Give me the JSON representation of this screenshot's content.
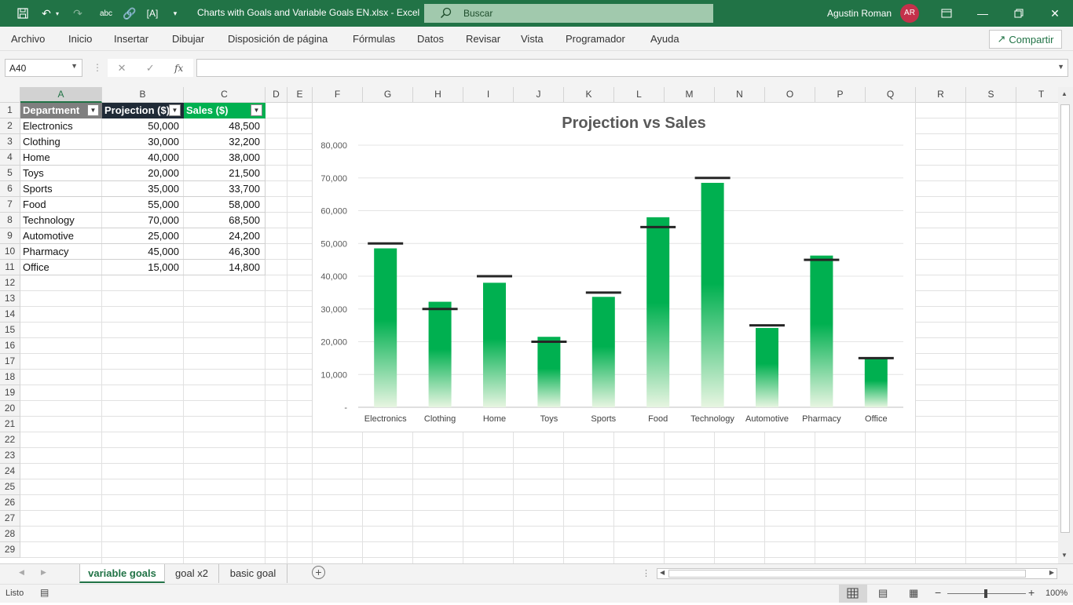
{
  "titlebar": {
    "title": "Charts with Goals and Variable Goals EN.xlsx  -  Excel",
    "search_placeholder": "Buscar",
    "user_name": "Agustin Roman",
    "user_initials": "AR"
  },
  "menu": [
    "Archivo",
    "Inicio",
    "Insertar",
    "Dibujar",
    "Disposición de página",
    "Fórmulas",
    "Datos",
    "Revisar",
    "Vista",
    "Programador",
    "Ayuda"
  ],
  "share_label": "Compartir",
  "formula_bar": {
    "name_box": "A40",
    "fx_label": "fx",
    "formula": ""
  },
  "columns": [
    "A",
    "B",
    "C",
    "D",
    "E",
    "F",
    "G",
    "H",
    "I",
    "J",
    "K",
    "L",
    "M",
    "N",
    "O",
    "P",
    "Q",
    "R",
    "S",
    "T"
  ],
  "rows": [
    "1",
    "2",
    "3",
    "4",
    "5",
    "6",
    "7",
    "8",
    "9",
    "10",
    "11",
    "12",
    "13",
    "14",
    "15",
    "16",
    "17",
    "18",
    "19",
    "20",
    "21",
    "22",
    "23",
    "24",
    "25",
    "26",
    "27",
    "28",
    "29"
  ],
  "table": {
    "headers": [
      "Department",
      "Projection ($)",
      "Sales ($)"
    ],
    "rows": [
      [
        "Electronics",
        "50,000",
        "48,500"
      ],
      [
        "Clothing",
        "30,000",
        "32,200"
      ],
      [
        "Home",
        "40,000",
        "38,000"
      ],
      [
        "Toys",
        "20,000",
        "21,500"
      ],
      [
        "Sports",
        "35,000",
        "33,700"
      ],
      [
        "Food",
        "55,000",
        "58,000"
      ],
      [
        "Technology",
        "70,000",
        "68,500"
      ],
      [
        "Automotive",
        "25,000",
        "24,200"
      ],
      [
        "Pharmacy",
        "45,000",
        "46,300"
      ],
      [
        "Office",
        "15,000",
        "14,800"
      ]
    ],
    "colors": {
      "dept_header": "#7f7f7f",
      "proj_header": "#1f2a36",
      "sales_header": "#00b050"
    }
  },
  "chart_data": {
    "type": "bar",
    "title": "Projection  vs Sales",
    "categories": [
      "Electronics",
      "Clothing",
      "Home",
      "Toys",
      "Sports",
      "Food",
      "Technology",
      "Automotive",
      "Pharmacy",
      "Office"
    ],
    "series": [
      {
        "name": "Sales ($)",
        "values": [
          48500,
          32200,
          38000,
          21500,
          33700,
          58000,
          68500,
          24200,
          46300,
          14800
        ],
        "color": "#00b050"
      },
      {
        "name": "Projection ($)",
        "values": [
          50000,
          30000,
          40000,
          20000,
          35000,
          55000,
          70000,
          25000,
          45000,
          15000
        ],
        "color": "#262626",
        "marker": "dash"
      }
    ],
    "ylim": [
      0,
      80000
    ],
    "y_ticks": [
      "-",
      "10,000",
      "20,000",
      "30,000",
      "40,000",
      "50,000",
      "60,000",
      "70,000",
      "80,000"
    ],
    "grid": true
  },
  "sheet_tabs": [
    "variable goals",
    "goal x2",
    "basic goal"
  ],
  "active_tab": 0,
  "status": {
    "ready": "Listo",
    "zoom": "100%"
  }
}
